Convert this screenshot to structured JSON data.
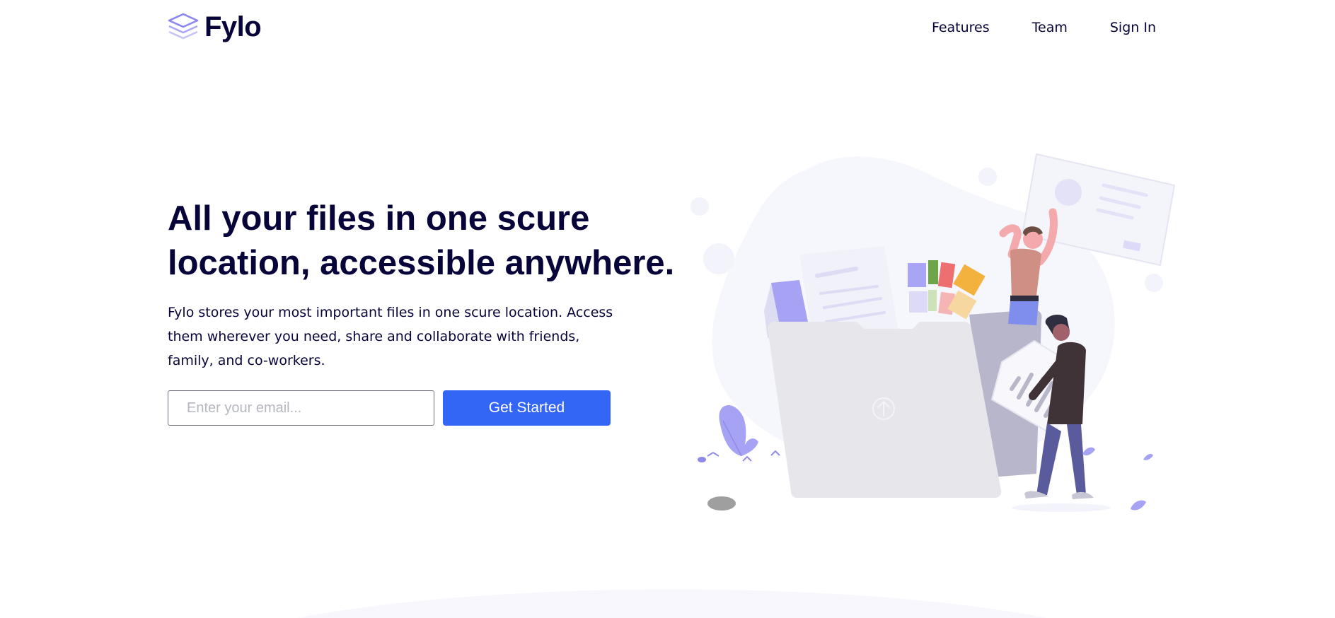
{
  "brand": {
    "name": "Fylo",
    "logo_icon": "stacked-layers-icon",
    "accent_color": "#6b66f0"
  },
  "nav": {
    "items": [
      {
        "label": "Features"
      },
      {
        "label": "Team"
      },
      {
        "label": "Sign In"
      }
    ]
  },
  "hero": {
    "title": "All your files in one scure location, accessible anywhere.",
    "description": "Fylo stores your most important files in one scure location. Access them wherever you need, share and collaborate with friends, family, and co-workers.",
    "email_placeholder": "Enter your email...",
    "cta_label": "Get Started",
    "cta_color": "#3366f5",
    "text_color": "#070439"
  },
  "illustration": {
    "name": "folder-upload-illustration",
    "upload_icon": "upload-arrow-icon"
  }
}
